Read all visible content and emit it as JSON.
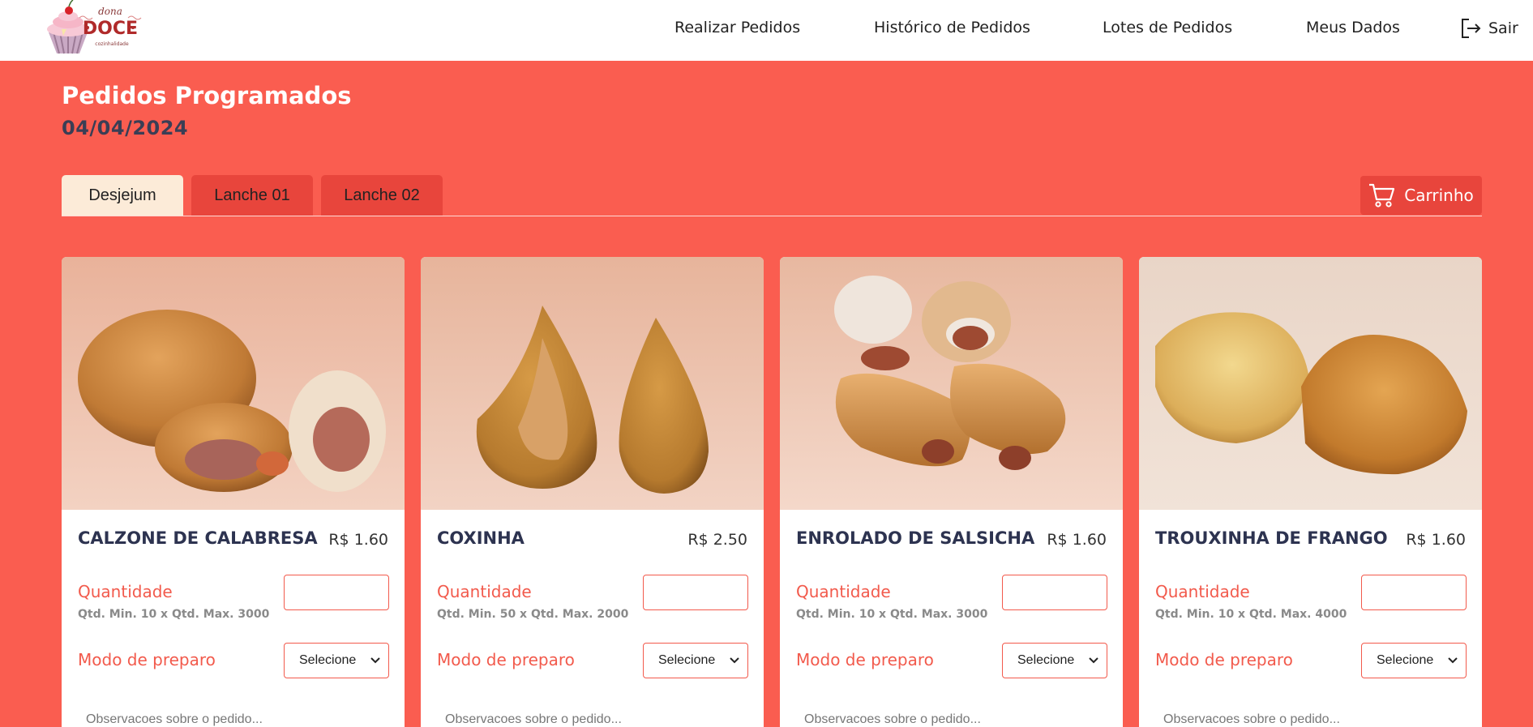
{
  "header": {
    "logo": {
      "line1": "dona",
      "line2": "DOCE",
      "line3": "cozinhalidade"
    },
    "nav": [
      "Realizar Pedidos",
      "Histórico de Pedidos",
      "Lotes de Pedidos",
      "Meus Dados"
    ],
    "logout_label": "Sair"
  },
  "page": {
    "title": "Pedidos Programados",
    "date": "04/04/2024"
  },
  "tabs": [
    {
      "label": "Desjejum",
      "active": true
    },
    {
      "label": "Lanche 01",
      "active": false
    },
    {
      "label": "Lanche 02",
      "active": false
    }
  ],
  "cart": {
    "label": "Carrinho",
    "icon": "cart-icon"
  },
  "products": [
    {
      "name": "CALZONE DE CALABRESA",
      "price": "R$ 1.60",
      "qty_label": "Quantidade",
      "qty_note": "Qtd. Min. 10 x  Qtd. Max. 3000",
      "qty_value": "",
      "prep_label": "Modo de preparo",
      "prep_value": "Selecione",
      "obs_placeholder": "Observacoes sobre o pedido..."
    },
    {
      "name": "COXINHA",
      "price": "R$ 2.50",
      "qty_label": "Quantidade",
      "qty_note": "Qtd. Min. 50 x  Qtd. Max. 2000",
      "qty_value": "",
      "prep_label": "Modo de preparo",
      "prep_value": "Selecione",
      "obs_placeholder": "Observacoes sobre o pedido..."
    },
    {
      "name": "ENROLADO DE SALSICHA",
      "price": "R$ 1.60",
      "qty_label": "Quantidade",
      "qty_note": "Qtd. Min. 10 x  Qtd. Max. 3000",
      "qty_value": "",
      "prep_label": "Modo de preparo",
      "prep_value": "Selecione",
      "obs_placeholder": "Observacoes sobre o pedido..."
    },
    {
      "name": "TROUXINHA DE FRANGO",
      "price": "R$ 1.60",
      "qty_label": "Quantidade",
      "qty_note": "Qtd. Min. 10 x  Qtd. Max. 4000",
      "qty_value": "",
      "prep_label": "Modo de preparo",
      "prep_value": "Selecione",
      "obs_placeholder": "Observacoes sobre o pedido..."
    }
  ],
  "colors": {
    "background": "#fa5d50",
    "accent": "#f25a4c",
    "tab_active": "#fcebd8",
    "tab_inactive": "#e8453c",
    "title_dark": "#2d3350"
  }
}
